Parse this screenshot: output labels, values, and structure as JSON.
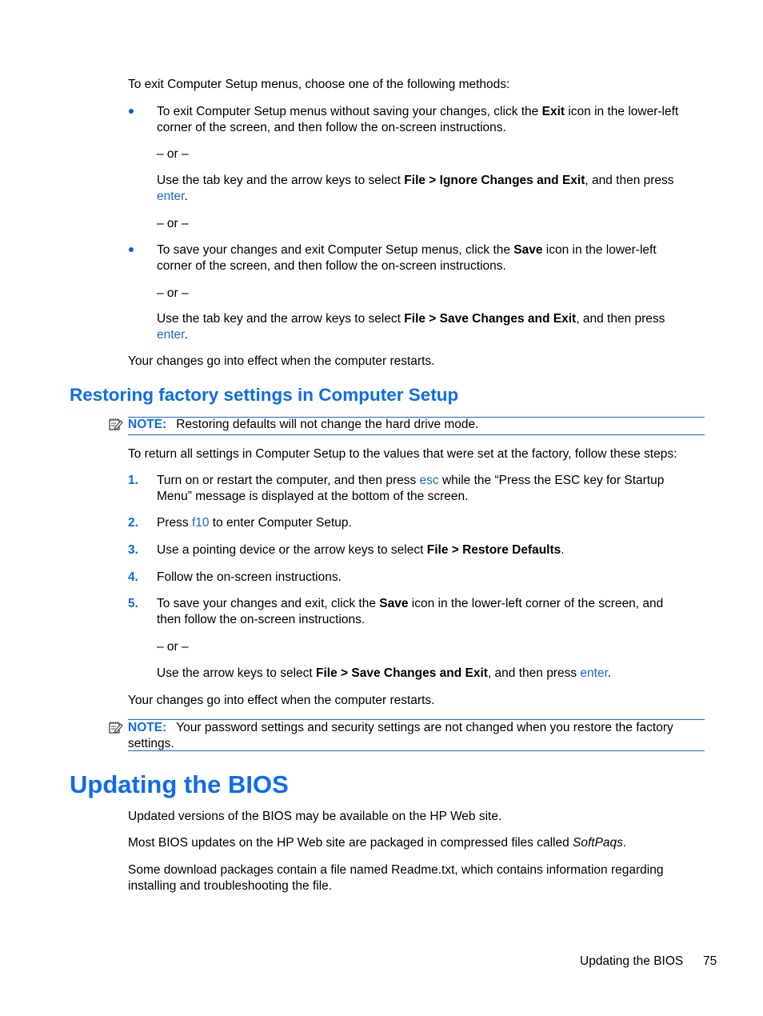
{
  "intro": "To exit Computer Setup menus, choose one of the following methods:",
  "exit_methods": [
    {
      "text_before": "To exit Computer Setup menus without saving your changes, click the ",
      "bold": "Exit",
      "text_after_line1": " icon in the lower-left",
      "line2": "corner of the screen, and then follow the on-screen instructions.",
      "or": "– or –",
      "alt_before": "Use the tab key and the arrow keys to select ",
      "alt_bold": "File > Ignore Changes and Exit",
      "alt_after": ", and then press",
      "alt_key": "enter",
      "alt_end": ".",
      "trailing_or": "– or –"
    },
    {
      "text_before": "To save your changes and exit Computer Setup menus, click the ",
      "bold": "Save",
      "text_after_line1": " icon in the lower-left",
      "line2": "corner of the screen, and then follow the on-screen instructions.",
      "or": "– or –",
      "alt_before": "Use the tab key and the arrow keys to select ",
      "alt_bold": "File > Save Changes and Exit",
      "alt_after": ", and then press",
      "alt_key": "enter",
      "alt_end": "."
    }
  ],
  "restart_note_1": "Your changes go into effect when the computer restarts.",
  "section_restore": {
    "heading": "Restoring factory settings in Computer Setup",
    "note_label": "NOTE:",
    "note_text": "Restoring defaults will not change the hard drive mode.",
    "intro": "To return all settings in Computer Setup to the values that were set at the factory, follow these steps:",
    "steps": [
      {
        "num": "1.",
        "before": "Turn on or restart the computer, and then press ",
        "key": "esc",
        "after": " while the “Press the ESC key for Startup",
        "line2": "Menu” message is displayed at the bottom of the screen."
      },
      {
        "num": "2.",
        "before": "Press ",
        "key": "f10",
        "after": " to enter Computer Setup."
      },
      {
        "num": "3.",
        "before": "Use a pointing device or the arrow keys to select ",
        "bold": "File > Restore Defaults",
        "after": "."
      },
      {
        "num": "4.",
        "text": "Follow the on-screen instructions."
      },
      {
        "num": "5.",
        "before": "To save your changes and exit, click the ",
        "bold": "Save",
        "after": " icon in the lower-left corner of the screen, and",
        "line2": "then follow the on-screen instructions.",
        "or": "– or –",
        "alt_before": "Use the arrow keys to select ",
        "alt_bold": "File > Save Changes and Exit",
        "alt_after": ", and then press ",
        "alt_key": "enter",
        "alt_end": "."
      }
    ],
    "restart_note": "Your changes go into effect when the computer restarts.",
    "note2_label": "NOTE:",
    "note2_line1": "Your password settings and security settings are not changed when you restore the factory",
    "note2_line2": "settings."
  },
  "section_bios": {
    "heading": "Updating the BIOS",
    "p1": "Updated versions of the BIOS may be available on the HP Web site.",
    "p2_before": "Most BIOS updates on the HP Web site are packaged in compressed files called ",
    "p2_italic": "SoftPaqs",
    "p2_end": ".",
    "p3_line1": "Some download packages contain a file named Readme.txt, which contains information regarding",
    "p3_line2": "installing and troubleshooting the file."
  },
  "footer": {
    "section": "Updating the BIOS",
    "page_number": "75"
  }
}
